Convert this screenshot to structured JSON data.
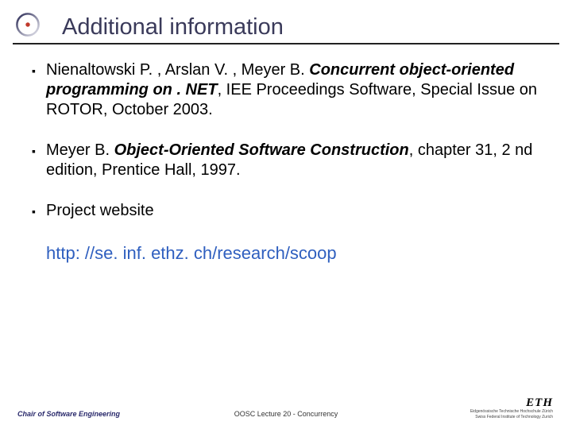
{
  "title": "Additional information",
  "bullets": [
    {
      "pre": "Nienaltowski P. , Arslan V. , Meyer B. ",
      "em": "Concurrent object-oriented programming on . NET",
      "post": ", IEE Proceedings Software, Special Issue on ROTOR, October 2003."
    },
    {
      "pre": "Meyer B. ",
      "em": "Object-Oriented Software Construction",
      "post": ", chapter 31, 2 nd edition, Prentice Hall, 1997."
    },
    {
      "pre": "Project website",
      "em": "",
      "post": ""
    }
  ],
  "link": "http: //se. inf. ethz. ch/research/scoop",
  "footer": {
    "left": "Chair of Software Engineering",
    "mid": "OOSC  Lecture 20 - Concurrency",
    "logo": "ETH",
    "logo_sub1": "Eidgenössische Technische Hochschule Zürich",
    "logo_sub2": "Swiss Federal Institute of Technology Zurich"
  }
}
